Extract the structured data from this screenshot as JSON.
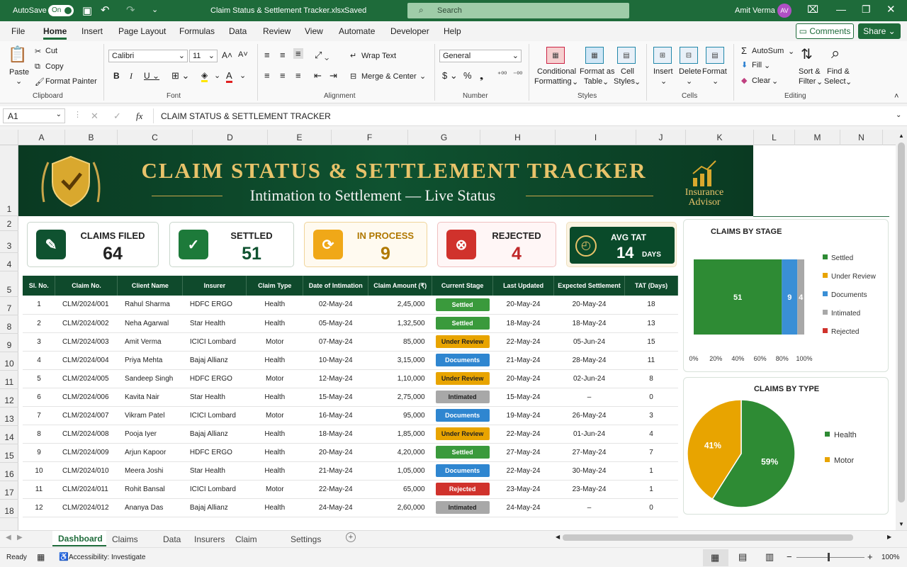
{
  "titlebar": {
    "autosave_label": "AutoSave",
    "autosave_state": "On",
    "file_title": "Claim Status & Settlement Tracker.xlsx",
    "saved_state": "Saved",
    "search_placeholder": "Search",
    "user_name": "Amit Verma",
    "user_initials": "AV"
  },
  "menu": [
    "File",
    "Home",
    "Insert",
    "Page Layout",
    "Formulas",
    "Data",
    "Review",
    "View",
    "Automate",
    "Developer",
    "Help"
  ],
  "menu_active": "Home",
  "comments_label": "Comments",
  "share_label": "Share",
  "ribbon": {
    "clipboard": {
      "paste": "Paste",
      "cut": "Cut",
      "copy": "Copy",
      "format_painter": "Format Painter",
      "group": "Clipboard"
    },
    "font": {
      "name": "Calibri",
      "size": "11",
      "group": "Font"
    },
    "alignment": {
      "wrap": "Wrap Text",
      "merge": "Merge & Center",
      "group": "Alignment"
    },
    "number": {
      "format": "General",
      "group": "Number"
    },
    "styles": {
      "cond1": "Conditional",
      "cond2": "Formatting",
      "fmt1": "Format as",
      "fmt2": "Table",
      "cell1": "Cell",
      "cell2": "Styles",
      "group": "Styles"
    },
    "cells": {
      "insert": "Insert",
      "delete": "Delete",
      "format": "Format",
      "group": "Cells"
    },
    "editing": {
      "autosum": "AutoSum",
      "fill": "Fill",
      "clear": "Clear",
      "sort1": "Sort &",
      "sort2": "Filter",
      "find1": "Find &",
      "find2": "Select",
      "group": "Editing"
    }
  },
  "formula": {
    "name_box": "A1",
    "fx": "fx",
    "content": "CLAIM STATUS & SETTLEMENT TRACKER"
  },
  "columns": [
    "A",
    "B",
    "C",
    "D",
    "E",
    "F",
    "G",
    "H",
    "I",
    "J",
    "K",
    "L",
    "M",
    "N"
  ],
  "rows": [
    "1",
    "2",
    "3",
    "4",
    "5",
    "7",
    "8",
    "9",
    "10",
    "11",
    "12",
    "13",
    "14",
    "15",
    "16",
    "17",
    "18"
  ],
  "banner": {
    "title": "CLAIM STATUS & SETTLEMENT TRACKER",
    "subtitle": "Intimation to Settlement — Live Status",
    "logo_line1": "Insurance",
    "logo_line2": "Advisor"
  },
  "kpis": {
    "filed": {
      "label": "CLAIMS FILED",
      "value": "64"
    },
    "settled": {
      "label": "SETTLED",
      "value": "51"
    },
    "process": {
      "label": "IN PROCESS",
      "value": "9"
    },
    "rejected": {
      "label": "REJECTED",
      "value": "4"
    },
    "tat": {
      "label": "AVG TAT",
      "value": "14",
      "unit": "DAYS"
    }
  },
  "table": {
    "headers": [
      "Sl. No.",
      "Claim No.",
      "Client Name",
      "Insurer",
      "Claim Type",
      "Date of Intimation",
      "Claim Amount (₹)",
      "Current Stage",
      "Last Updated",
      "Expected Settlement",
      "TAT (Days)"
    ],
    "rows": [
      [
        "1",
        "CLM/2024/001",
        "Rahul Sharma",
        "HDFC ERGO",
        "Health",
        "02-May-24",
        "2,45,000",
        "Settled",
        "20-May-24",
        "20-May-24",
        "18"
      ],
      [
        "2",
        "CLM/2024/002",
        "Neha Agarwal",
        "Star Health",
        "Health",
        "05-May-24",
        "1,32,500",
        "Settled",
        "18-May-24",
        "18-May-24",
        "13"
      ],
      [
        "3",
        "CLM/2024/003",
        "Amit Verma",
        "ICICI Lombard",
        "Motor",
        "07-May-24",
        "85,000",
        "Under Review",
        "22-May-24",
        "05-Jun-24",
        "15"
      ],
      [
        "4",
        "CLM/2024/004",
        "Priya Mehta",
        "Bajaj Allianz",
        "Health",
        "10-May-24",
        "3,15,000",
        "Documents",
        "21-May-24",
        "28-May-24",
        "11"
      ],
      [
        "5",
        "CLM/2024/005",
        "Sandeep Singh",
        "HDFC ERGO",
        "Motor",
        "12-May-24",
        "1,10,000",
        "Under Review",
        "20-May-24",
        "02-Jun-24",
        "8"
      ],
      [
        "6",
        "CLM/2024/006",
        "Kavita Nair",
        "Star Health",
        "Health",
        "15-May-24",
        "2,75,000",
        "Intimated",
        "15-May-24",
        "–",
        "0"
      ],
      [
        "7",
        "CLM/2024/007",
        "Vikram Patel",
        "ICICI Lombard",
        "Motor",
        "16-May-24",
        "95,000",
        "Documents",
        "19-May-24",
        "26-May-24",
        "3"
      ],
      [
        "8",
        "CLM/2024/008",
        "Pooja Iyer",
        "Bajaj Allianz",
        "Health",
        "18-May-24",
        "1,85,000",
        "Under Review",
        "22-May-24",
        "01-Jun-24",
        "4"
      ],
      [
        "9",
        "CLM/2024/009",
        "Arjun Kapoor",
        "HDFC ERGO",
        "Health",
        "20-May-24",
        "4,20,000",
        "Settled",
        "27-May-24",
        "27-May-24",
        "7"
      ],
      [
        "10",
        "CLM/2024/010",
        "Meera Joshi",
        "Star Health",
        "Health",
        "21-May-24",
        "1,05,000",
        "Documents",
        "22-May-24",
        "30-May-24",
        "1"
      ],
      [
        "11",
        "CLM/2024/011",
        "Rohit Bansal",
        "ICICI Lombard",
        "Motor",
        "22-May-24",
        "65,000",
        "Rejected",
        "23-May-24",
        "23-May-24",
        "1"
      ],
      [
        "12",
        "CLM/2024/012",
        "Ananya Das",
        "Bajaj Allianz",
        "Health",
        "24-May-24",
        "2,60,000",
        "Intimated",
        "24-May-24",
        "–",
        "0"
      ]
    ]
  },
  "stage_colors": {
    "Settled": "#3a9a3c",
    "Under Review": "#e8a400",
    "Documents": "#2f86d0",
    "Intimated": "#a8a8a8",
    "Rejected": "#d0322c"
  },
  "chart_data": [
    {
      "type": "bar",
      "title": "CLAIMS BY STAGE",
      "orientation": "horizontal-stacked-100%",
      "series": [
        {
          "name": "Settled",
          "values": [
            51
          ],
          "color": "#2e8b34"
        },
        {
          "name": "Under Review",
          "values": [
            0
          ],
          "color": "#e8a400"
        },
        {
          "name": "Documents",
          "values": [
            9
          ],
          "color": "#3a8fd6"
        },
        {
          "name": "Intimated",
          "values": [
            4
          ],
          "color": "#a8a8a8"
        },
        {
          "name": "Rejected",
          "values": [
            0
          ],
          "color": "#d0322c"
        }
      ],
      "xticks": [
        "0%",
        "20%",
        "40%",
        "60%",
        "80%",
        "100%"
      ],
      "legend": "right"
    },
    {
      "type": "pie",
      "title": "CLAIMS BY TYPE",
      "labels": [
        "Health",
        "Motor"
      ],
      "values": [
        59,
        41
      ],
      "display": [
        "59%",
        "41%"
      ],
      "colors": [
        "#2e8b34",
        "#e8a400"
      ],
      "legend": "right"
    }
  ],
  "sheet_tabs": [
    "Dashboard",
    "Claims List",
    "Data",
    "Insurers",
    "Claim Types",
    "Settings"
  ],
  "active_tab": "Dashboard",
  "status": {
    "ready": "Ready",
    "accessibility": "Accessibility: Investigate",
    "zoom": "100%"
  }
}
